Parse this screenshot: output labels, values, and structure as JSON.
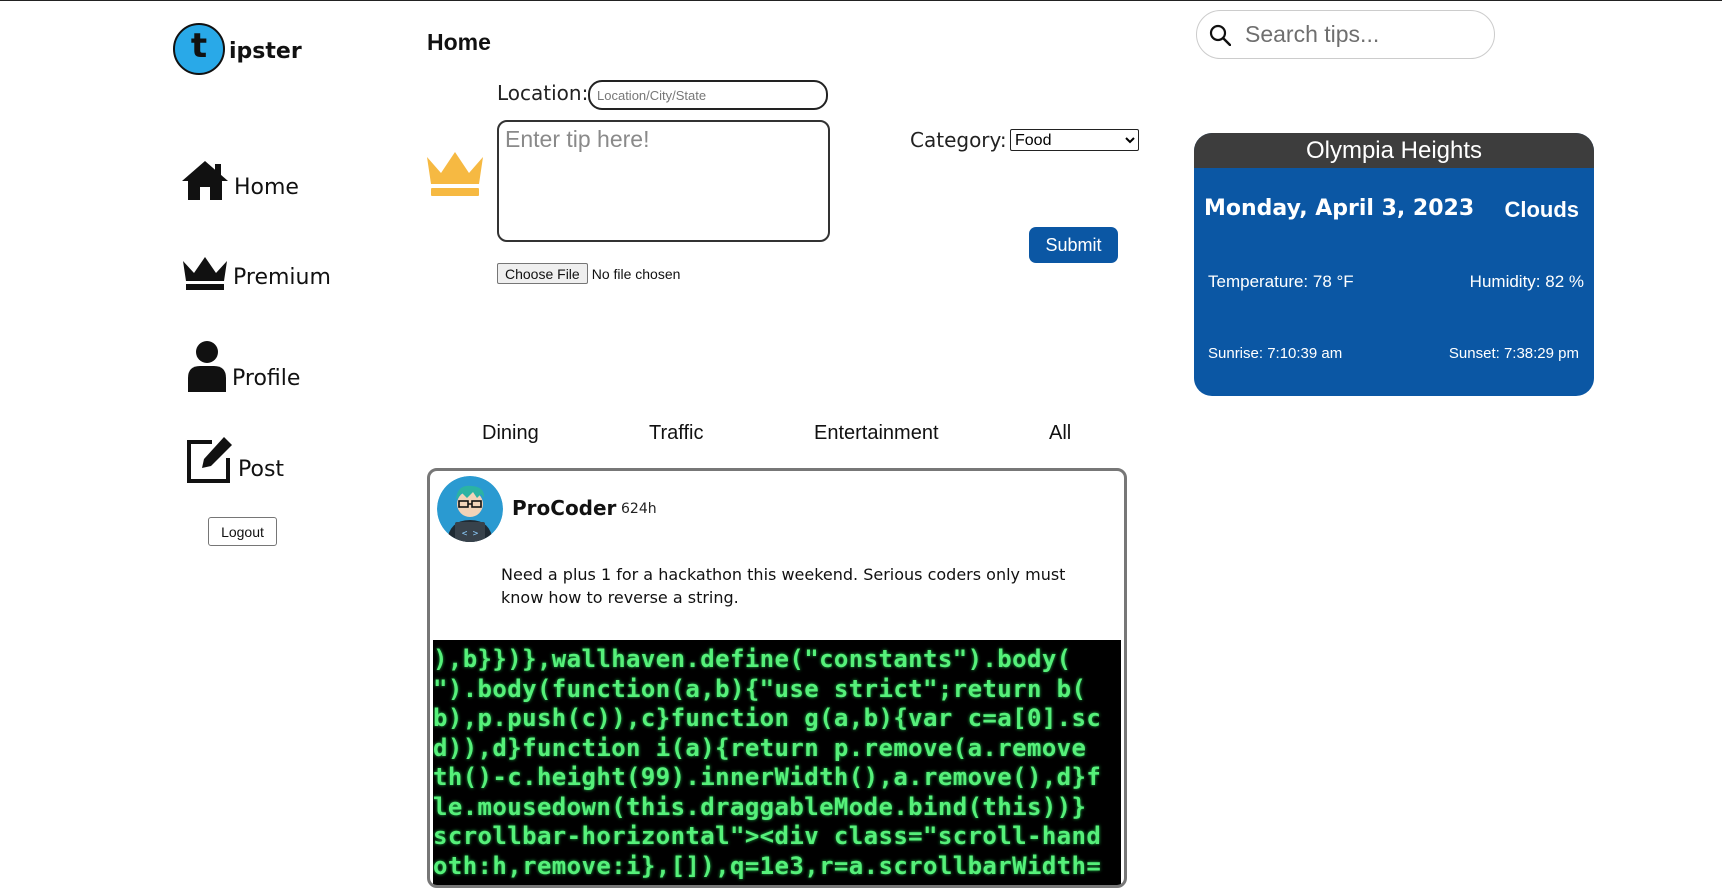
{
  "logo": {
    "letter": "t",
    "text": "ipster"
  },
  "nav": {
    "items": [
      {
        "label": "Home",
        "icon": "home-icon"
      },
      {
        "label": "Premium",
        "icon": "crown-icon"
      },
      {
        "label": "Profile",
        "icon": "user-icon"
      },
      {
        "label": "Post",
        "icon": "edit-icon"
      }
    ],
    "logout_label": "Logout"
  },
  "header": {
    "title": "Home"
  },
  "search": {
    "placeholder": "Search tips..."
  },
  "form": {
    "location_label": "Location:",
    "location_placeholder": "Location/City/State",
    "tip_placeholder": "Enter tip here!",
    "file_button": "Choose File",
    "file_status": "No file chosen",
    "category_label": "Category:",
    "category_selected": "Food",
    "submit_label": "Submit"
  },
  "weather": {
    "city": "Olympia Heights",
    "date": "Monday, April 3, 2023",
    "condition": "Clouds",
    "temperature": "Temperature: 78 °F",
    "humidity": "Humidity: 82 %",
    "sunrise": "Sunrise: 7:10:39 am",
    "sunset": "Sunset: 7:38:29 pm"
  },
  "tabs": [
    "Dining",
    "Traffic",
    "Entertainment",
    "All"
  ],
  "post": {
    "author": "ProCoder",
    "age": "624h",
    "text": "Need a plus 1 for a hackathon this weekend. Serious coders only must know how to reverse a string.",
    "image_code_lines": [
      "),b}})},wallhaven.define(\"constants\").body(",
      "\").body(function(a,b){\"use strict\";return b(",
      "b),p.push(c)),c}function g(a,b){var c=a[0].sc",
      "d)),d}function i(a){return p.remove(a.remove",
      "th()-c.height(99).innerWidth(),a.remove(),d}f",
      "le.mousedown(this.draggableMode.bind(this))}",
      "scrollbar-horizontal\"><div class=\"scroll-hand",
      "oth:h,remove:i},[]),q=1e3,r=a.scrollbarWidth="
    ]
  },
  "colors": {
    "accent_blue": "#0b57a4",
    "crown_gold": "#f6b942",
    "logo_blue": "#29a9e8",
    "weather_head": "#3d3d3d",
    "code_green": "#56f07a"
  }
}
